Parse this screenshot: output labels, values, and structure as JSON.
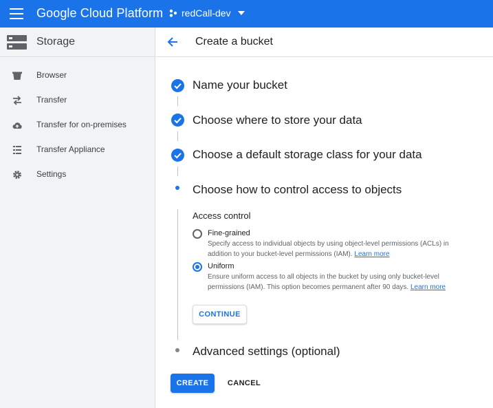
{
  "topbar": {
    "brand": "Google Cloud Platform",
    "project": "redCall-dev"
  },
  "sidebar": {
    "title": "Storage",
    "items": [
      {
        "label": "Browser",
        "icon": "bucket-icon"
      },
      {
        "label": "Transfer",
        "icon": "swap-arrows-icon"
      },
      {
        "label": "Transfer for on-premises",
        "icon": "cloud-upload-icon"
      },
      {
        "label": "Transfer Appliance",
        "icon": "appliance-list-icon"
      },
      {
        "label": "Settings",
        "icon": "gear-icon"
      }
    ]
  },
  "main": {
    "title": "Create a bucket",
    "steps": [
      {
        "title": "Name your bucket",
        "status": "complete"
      },
      {
        "title": "Choose where to store your data",
        "status": "complete"
      },
      {
        "title": "Choose a default storage class for your data",
        "status": "complete"
      },
      {
        "title": "Choose how to control access to objects",
        "status": "active"
      },
      {
        "title": "Advanced settings (optional)",
        "status": "pending"
      }
    ],
    "access_control": {
      "label": "Access control",
      "options": [
        {
          "label": "Fine-grained",
          "desc_line1": "Specify access to individual objects by using object-level permissions (ACLs) in",
          "desc_line2": "addition to your bucket-level permissions (IAM).",
          "link": "Learn more",
          "selected": false
        },
        {
          "label": "Uniform",
          "desc_line1": "Ensure uniform access to all objects in the bucket by using only bucket-level",
          "desc_line2": "permissions (IAM). This option becomes permanent after 90 days.",
          "link": "Learn more",
          "selected": true
        }
      ]
    },
    "continue_label": "CONTINUE",
    "create_label": "CREATE",
    "cancel_label": "CANCEL"
  },
  "colors": {
    "accent": "#1a73e8",
    "sidebar_bg": "#f1f3f4",
    "pending_dot": "#80868b"
  }
}
